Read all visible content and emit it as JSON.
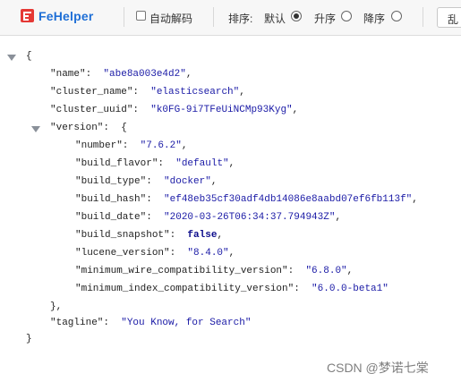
{
  "toolbar": {
    "brand": "FeHelper",
    "auto_decode_label": "自动解码",
    "sort_label": "排序:",
    "sort_options": [
      "默认",
      "升序",
      "降序"
    ],
    "more_button": "乱"
  },
  "json": {
    "name_key": "\"name\":",
    "name_val": "\"abe8a003e4d2\"",
    "cluster_name_key": "\"cluster_name\":",
    "cluster_name_val": "\"elasticsearch\"",
    "cluster_uuid_key": "\"cluster_uuid\":",
    "cluster_uuid_val": "\"k0FG-9i7TFeUiNCMp93Kyg\"",
    "version_key": "\"version\":",
    "number_key": "\"number\":",
    "number_val": "\"7.6.2\"",
    "build_flavor_key": "\"build_flavor\":",
    "build_flavor_val": "\"default\"",
    "build_type_key": "\"build_type\":",
    "build_type_val": "\"docker\"",
    "build_hash_key": "\"build_hash\":",
    "build_hash_val": "\"ef48eb35cf30adf4db14086e8aabd07ef6fb113f\"",
    "build_date_key": "\"build_date\":",
    "build_date_val": "\"2020-03-26T06:34:37.794943Z\"",
    "build_snapshot_key": "\"build_snapshot\":",
    "build_snapshot_val": "false",
    "lucene_version_key": "\"lucene_version\":",
    "lucene_version_val": "\"8.4.0\"",
    "min_wire_key": "\"minimum_wire_compatibility_version\":",
    "min_wire_val": "\"6.8.0\"",
    "min_index_key": "\"minimum_index_compatibility_version\":",
    "min_index_val": "\"6.0.0-beta1\"",
    "tagline_key": "\"tagline\":",
    "tagline_val": "\"You Know, for Search\""
  },
  "watermark": "CSDN @梦诺七棠",
  "colors": {
    "brand": "#1f6fd6",
    "string": "#1a1aa6",
    "boolean": "#0d0d8c"
  }
}
